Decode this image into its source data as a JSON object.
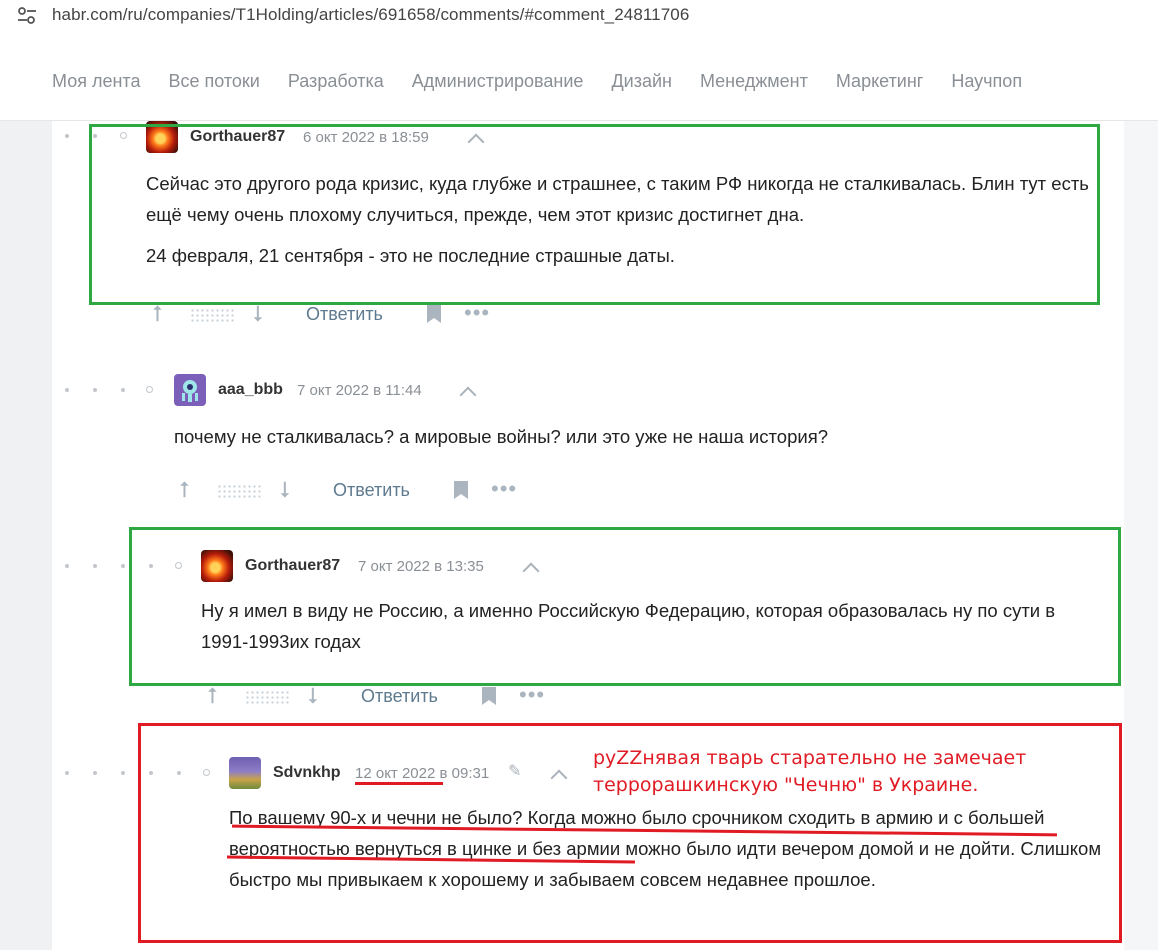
{
  "browser": {
    "url": "habr.com/ru/companies/T1Holding/articles/691658/comments/#comment_24811706"
  },
  "nav": {
    "items": [
      "Моя лента",
      "Все потоки",
      "Разработка",
      "Администрирование",
      "Дизайн",
      "Менеджмент",
      "Маркетинг",
      "Научпоп"
    ]
  },
  "comments": [
    {
      "author": "Gorthauer87",
      "date": "6 окт 2022 в 18:59",
      "paragraphs": [
        "Сейчас это другого рода кризис, куда глубже и страшнее, с таким РФ никогда не сталкивалась. Блин тут есть ещё чему очень плохому случиться, прежде, чем этот кризис достигнет дна.",
        "24 февраля, 21 сентября - это не последние страшные даты."
      ],
      "reply_label": "Ответить"
    },
    {
      "author": "aaa_bbb",
      "date": "7 окт 2022 в 11:44",
      "paragraphs": [
        "почему не сталкивалась? а мировые войны? или это уже не наша история?"
      ],
      "reply_label": "Ответить"
    },
    {
      "author": "Gorthauer87",
      "date": "7 окт 2022 в 13:35",
      "paragraphs": [
        "Ну я имел в виду не Россию, а именно Российскую Федерацию, которая образовалась ну по сути в 1991-1993их годах"
      ],
      "reply_label": "Ответить"
    },
    {
      "author": "Sdvnkhp",
      "date_part": "12 окт 2022",
      "time_part": "в 09:31",
      "paragraphs": [
        "По вашему 90-х и чечни не было? Когда можно было срочником сходить в армию и с большей вероятностью вернуться в цинке и без армии можно было идти вечером домой и не дойти. Слишком быстро мы привыкаем к хорошему и забываем совсем недавнее прошлое."
      ]
    }
  ],
  "annotation": {
    "line1": "руZZнявая тварь старательно не замечает",
    "line2": "террорашкинскую \"Чечню\" в Украине."
  },
  "colors": {
    "green_box": "#2ea843",
    "red_box": "#e01b24",
    "reply_link": "#5e7a8f"
  }
}
